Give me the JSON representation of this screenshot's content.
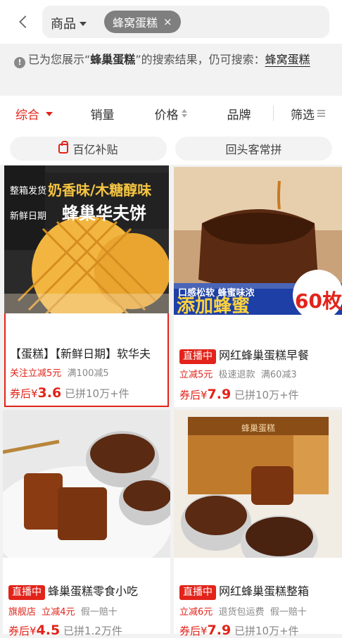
{
  "search": {
    "scope_label": "商品",
    "query_chip": "蜂窝蛋糕",
    "clear": "×"
  },
  "notice": {
    "prefix": "已为您展示“",
    "term": "蜂巢蛋糕",
    "suffix": "”的搜索结果，仍可搜索：",
    "alt_query": "蜂窝蛋糕"
  },
  "sort_bar": {
    "comprehensive": "综合",
    "sales": "销量",
    "price": "价格",
    "brand": "品牌",
    "filter": "筛选"
  },
  "quick_filters": [
    "百亿补贴",
    "回头客常拼"
  ],
  "products": [
    {
      "live": "",
      "title": "【蛋糕】【新鲜日期】软华夫",
      "tag1": "关注立减5元",
      "tag2": "满100减5",
      "tag3": "",
      "price_prefix": "券后¥",
      "price": "3.6",
      "sold": "已拼10万+件",
      "img_text": [
        "整箱发货",
        "新鲜日期",
        "奶香味/木糖醇味",
        "蜂巢华夫饼"
      ]
    },
    {
      "live": "直播中",
      "title": "网红蜂巢蛋糕早餐",
      "tag1": "立减5元",
      "tag2": "极速退款",
      "tag3": "满60减3",
      "price_prefix": "券后¥",
      "price": "7.9",
      "sold": "已拼10万+件",
      "img_text": [
        "口感松软 蜂蜜味浓",
        "添加蜂蜜",
        "60枚"
      ]
    },
    {
      "live": "直播中",
      "title": "蜂巢蛋糕零食小吃",
      "tag1": "旗舰店",
      "tag2": "立减4元",
      "tag3": "假一赔十",
      "price_prefix": "券后¥",
      "price": "4.5",
      "sold": "已拼1.2万件",
      "img_text": []
    },
    {
      "live": "直播中",
      "title": "网红蜂巢蛋糕整箱",
      "tag1": "立减6元",
      "tag2": "退货包运费",
      "tag3": "假一赔十",
      "price_prefix": "券后¥",
      "price": "7.9",
      "sold": "已拼10万+件",
      "img_text": [
        "蜂巢蛋糕"
      ]
    }
  ],
  "colors": {
    "accent": "#e2231a",
    "waffle": "#f2b640",
    "cake": "#5a2a12"
  }
}
